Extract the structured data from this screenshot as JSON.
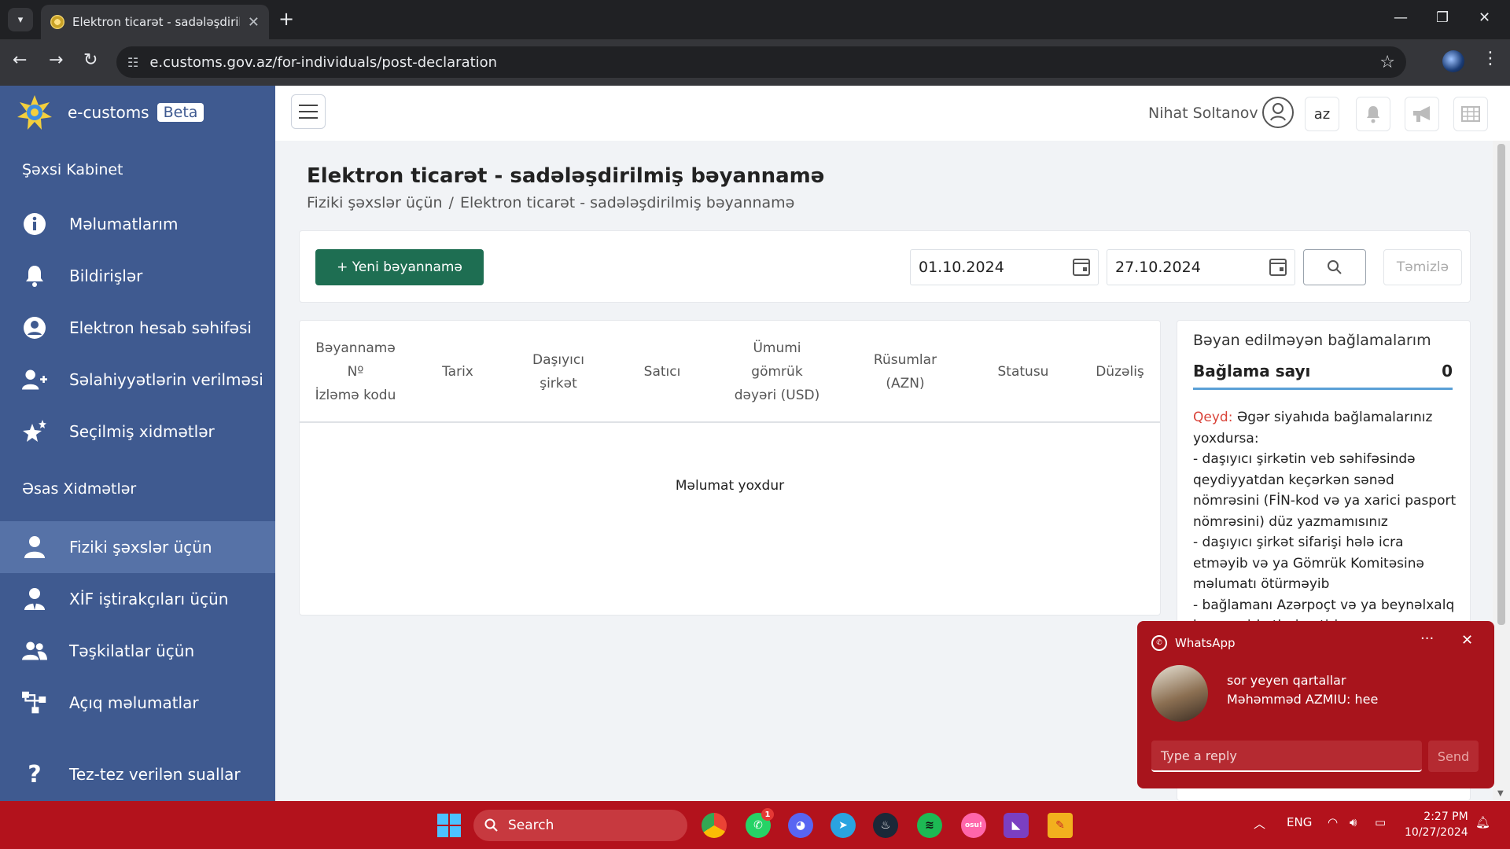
{
  "browser": {
    "tab_title": "Elektron ticarət - sadələşdirilmiş",
    "url": "e.customs.gov.az/for-individuals/post-declaration"
  },
  "sidebar": {
    "brand": "e-customs",
    "beta": "Beta",
    "section1": "Şəxsi Kabinet",
    "section2": "Əsas Xidmətlər",
    "items": [
      {
        "label": "Məlumatlarım",
        "icon": "info-icon"
      },
      {
        "label": "Bildirişlər",
        "icon": "bell-icon"
      },
      {
        "label": "Elektron hesab səhifəsi",
        "icon": "user-circle-icon"
      },
      {
        "label": "Səlahiyyətlərin verilməsi",
        "icon": "user-plus-icon"
      },
      {
        "label": "Seçilmiş xidmətlər",
        "icon": "stars-icon"
      },
      {
        "label": "Fiziki şəxslər üçün",
        "icon": "user-icon"
      },
      {
        "label": "XİF iştirakçıları üçün",
        "icon": "user-tie-icon"
      },
      {
        "label": "Təşkilatlar üçün",
        "icon": "users-icon"
      },
      {
        "label": "Açıq məlumatlar",
        "icon": "sitemap-icon"
      },
      {
        "label": "Tez-tez verilən suallar",
        "icon": "question-icon"
      }
    ]
  },
  "topbar": {
    "user_name": "Nihat Soltanov",
    "lang": "az"
  },
  "page": {
    "title": "Elektron ticarət - sadələşdirilmiş bəyannamə",
    "breadcrumb_root": "Fiziki şəxslər üçün",
    "breadcrumb_sep": "/",
    "breadcrumb_current": "Elektron ticarət - sadələşdirilmiş bəyannamə"
  },
  "toolbar": {
    "new_button": "+ Yeni bəyannamə",
    "date_from": "01.10.2024",
    "date_to": "27.10.2024",
    "clear_button": "Təmizlə"
  },
  "table": {
    "columns": [
      "Bəyannamə\nNº\nİzləmə kodu",
      "Tarix",
      "Daşıyıcı\nşirkət",
      "Satıcı",
      "Ümumi\ngömrük\ndəyəri (USD)",
      "Rüsumlar\n(AZN)",
      "Statusu",
      "Düzəliş"
    ],
    "empty": "Məlumat yoxdur"
  },
  "packages": {
    "title": "Bəyan edilməyən bağlamalarım",
    "count_label": "Bağlama sayı",
    "count": "0",
    "note_label": "Qeyd:",
    "note_text": "Əgər siyahıda bağlamalarınız yoxdursa:",
    "note_items": [
      "- daşıyıcı şirkətin veb səhifəsində qeydiyyatdan keçərkən sənəd nömrəsini (FİN-kod və ya xarici pasport nömrəsini) düz yazmamısınız",
      "- daşıyıcı şirkət sifarişi hələ icra etməyib və ya Gömrük Komitəsinə məlumatı ötürməyib",
      "- bağlamanı Azərpoçt və ya beynəlxalq kuryer şirkətləri gətirir"
    ]
  },
  "whatsapp": {
    "app": "WhatsApp",
    "group": "sor yeyen qartallar",
    "message": "Məhəmməd AZMIU: hee",
    "reply_placeholder": "Type a reply",
    "send": "Send"
  },
  "taskbar": {
    "search": "Search",
    "lang": "ENG",
    "time": "2:27 PM",
    "date": "10/27/2024",
    "whatsapp_badge": "1"
  },
  "colors": {
    "sidebar": "#3f5a90",
    "primary_button": "#1e6e52",
    "taskbar": "#b3121c",
    "notification": "#a8141c"
  }
}
